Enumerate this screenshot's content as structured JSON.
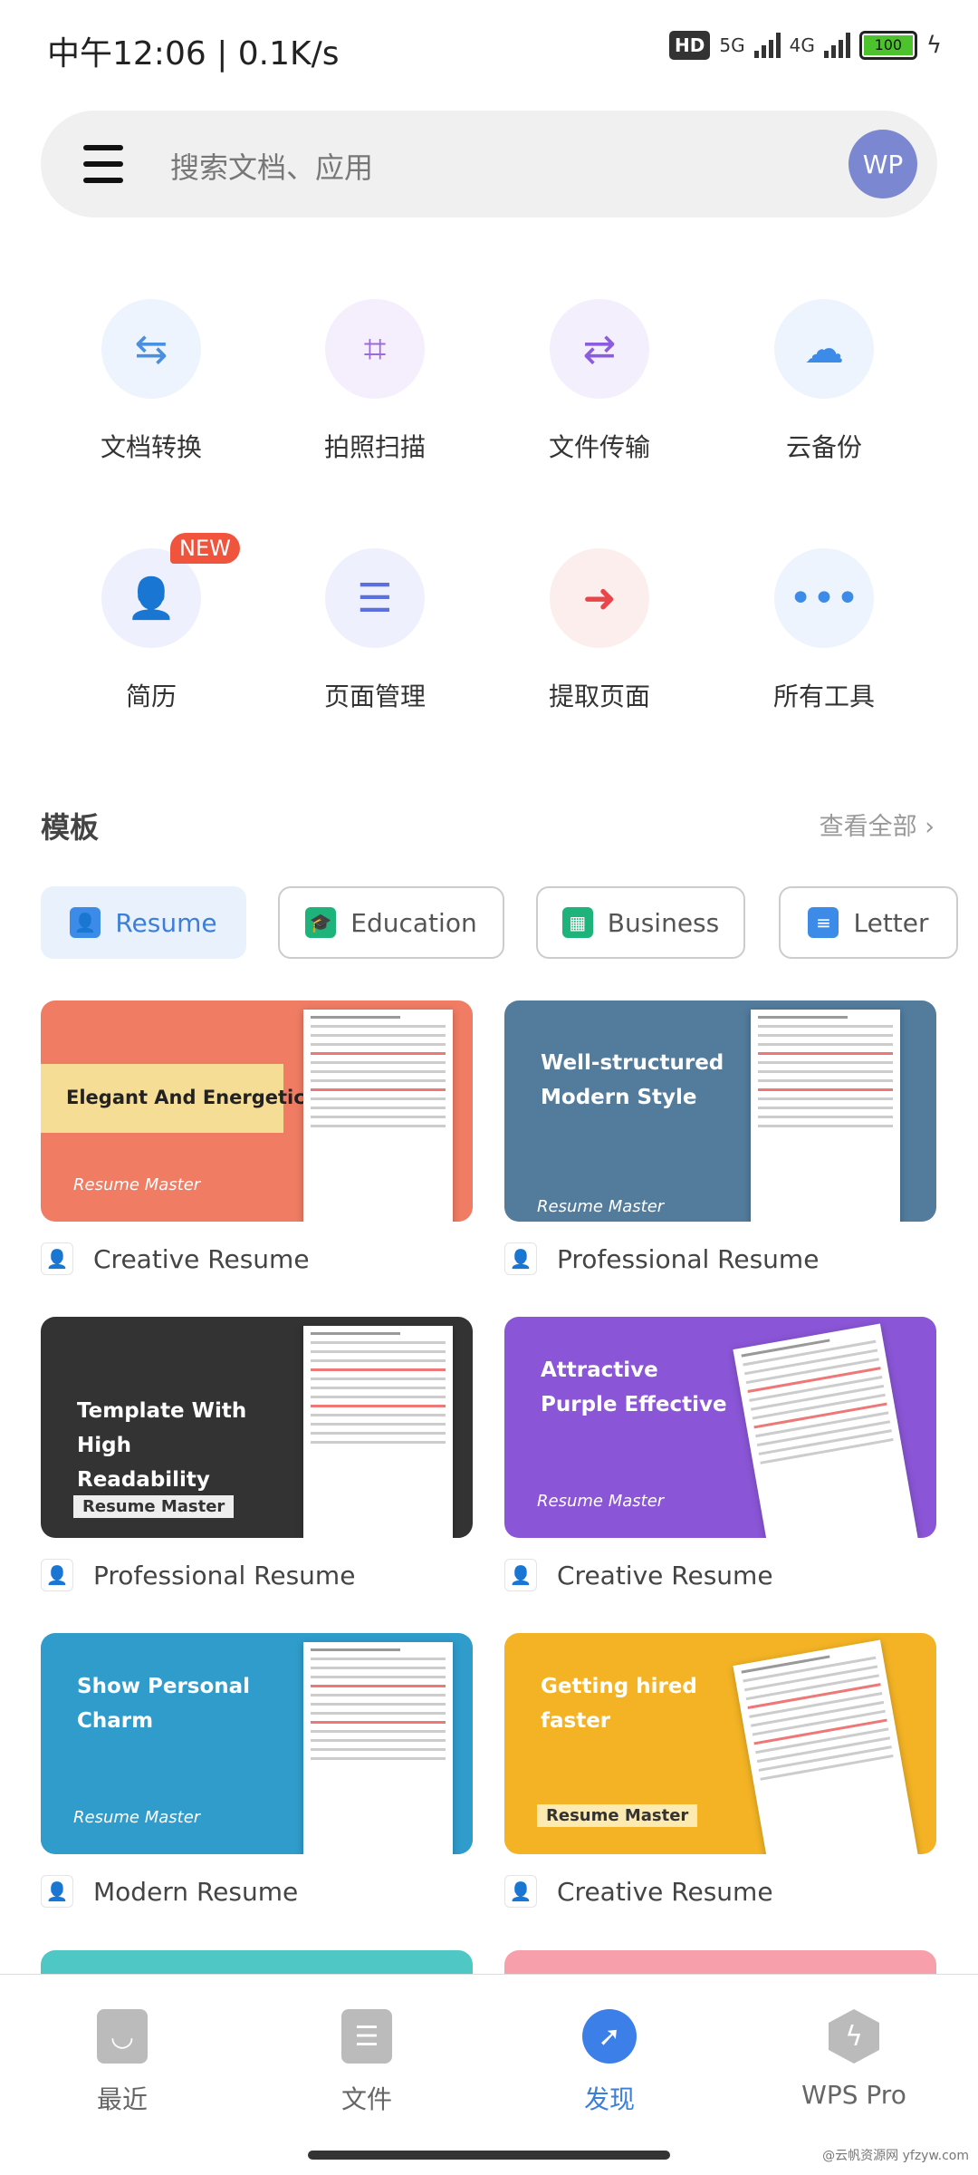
{
  "status_bar": {
    "time": "中午12:06 | 0.1K/s",
    "hd": "HD",
    "net1": "5G",
    "net2": "4G",
    "battery": "100"
  },
  "search": {
    "placeholder": "搜索文档、应用",
    "avatar": "WP"
  },
  "tools": [
    {
      "label": "文档转换",
      "icon": "file-convert-icon",
      "color": "#4a90e2"
    },
    {
      "label": "拍照扫描",
      "icon": "scan-icon",
      "color": "#9b6bdc"
    },
    {
      "label": "文件传输",
      "icon": "transfer-icon",
      "color": "#8c5ce0"
    },
    {
      "label": "云备份",
      "icon": "cloud-icon",
      "color": "#3d8be8"
    },
    {
      "label": "简历",
      "icon": "resume-icon",
      "color": "#5b6fe0",
      "badge": "NEW"
    },
    {
      "label": "页面管理",
      "icon": "page-manage-icon",
      "color": "#5b6fe0"
    },
    {
      "label": "提取页面",
      "icon": "extract-page-icon",
      "color": "#e8464a"
    },
    {
      "label": "所有工具",
      "icon": "more-icon",
      "color": "#3d8be8"
    }
  ],
  "templates": {
    "title": "模板",
    "view_all": "查看全部",
    "chips": [
      {
        "label": "Resume",
        "active": true,
        "color": "#3d8be8"
      },
      {
        "label": "Education",
        "color": "#1db37a"
      },
      {
        "label": "Business",
        "color": "#1db37a"
      },
      {
        "label": "Letter",
        "color": "#3d8be8"
      }
    ],
    "cards": [
      {
        "headline": "Elegant And Energetic",
        "brand": "Resume Master",
        "name": "Creative Resume",
        "bg": "#f07c64"
      },
      {
        "headline": "Well-structured Modern Style",
        "brand": "Resume Master",
        "name": "Professional Resume",
        "bg": "#527b9c"
      },
      {
        "headline": "Template With High Readability",
        "brand": "Resume Master",
        "name": "Professional Resume",
        "bg": "#333333"
      },
      {
        "headline": "Attractive Purple Effective",
        "brand": "Resume Master",
        "name": "Creative Resume",
        "bg": "#8a55d6"
      },
      {
        "headline": "Show Personal Charm",
        "brand": "Resume Master",
        "name": "Modern Resume",
        "bg": "#2f9ccc"
      },
      {
        "headline": "Getting hired faster",
        "brand": "Resume Master",
        "name": "Creative Resume",
        "bg": "#f3b324"
      }
    ]
  },
  "nav": [
    {
      "label": "最近"
    },
    {
      "label": "文件"
    },
    {
      "label": "发现",
      "active": true
    },
    {
      "label": "WPS Pro"
    }
  ],
  "watermark": "@云帆资源网 yfzyw.com"
}
